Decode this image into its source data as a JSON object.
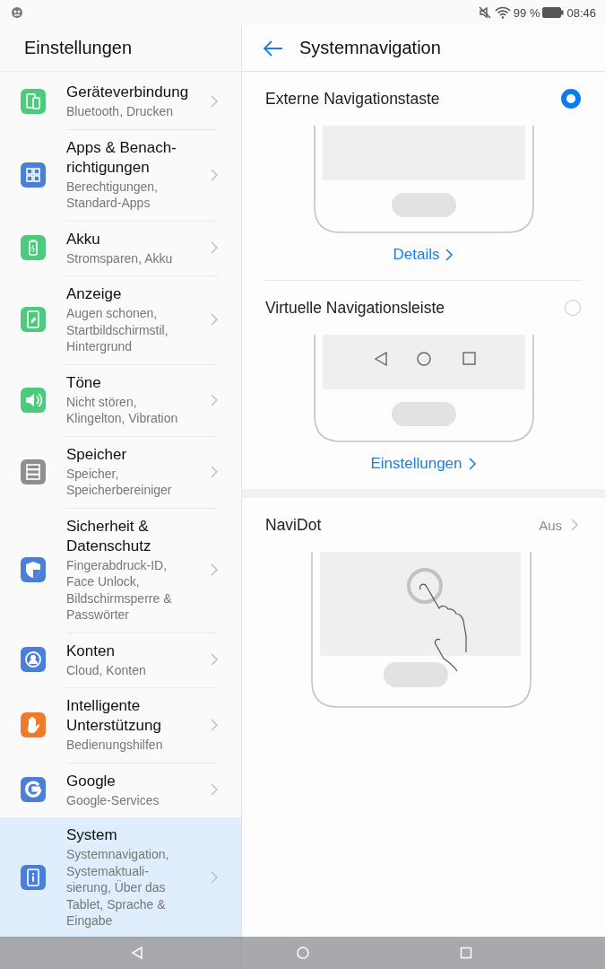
{
  "status_bar": {
    "battery": "99 %",
    "time": "08:46"
  },
  "sidebar": {
    "title": "Einstellungen",
    "items": [
      {
        "title_lines": [
          "Geräteverbindung"
        ],
        "subtitle_lines": [
          "Bluetooth, Drucken"
        ],
        "color": "#4ccb7d",
        "selected": false
      },
      {
        "title_lines": [
          "Apps & Benach-",
          "richtigungen"
        ],
        "subtitle_lines": [
          "Berechtigungen,",
          "Standard-Apps"
        ],
        "color": "#4a7fd9",
        "selected": false
      },
      {
        "title_lines": [
          "Akku"
        ],
        "subtitle_lines": [
          "Stromsparen, Akku"
        ],
        "color": "#4ccb7d",
        "selected": false
      },
      {
        "title_lines": [
          "Anzeige"
        ],
        "subtitle_lines": [
          "Augen schonen,",
          "Startbildschirmstil,",
          "Hintergrund"
        ],
        "color": "#4ccb7d",
        "selected": false
      },
      {
        "title_lines": [
          "Töne"
        ],
        "subtitle_lines": [
          "Nicht stören,",
          "Klingelton, Vibration"
        ],
        "color": "#4ccb7d",
        "selected": false
      },
      {
        "title_lines": [
          "Speicher"
        ],
        "subtitle_lines": [
          "Speicher,",
          "Speicherbereiniger"
        ],
        "color": "#8f8f8f",
        "selected": false
      },
      {
        "title_lines": [
          "Sicherheit &",
          "Datenschutz"
        ],
        "subtitle_lines": [
          "Fingerabdruck-ID,",
          "Face Unlock,",
          "Bildschirmsperre &",
          "Passwörter"
        ],
        "color": "#4a7fd9",
        "selected": false
      },
      {
        "title_lines": [
          "Konten"
        ],
        "subtitle_lines": [
          "Cloud, Konten"
        ],
        "color": "#4a7fd9",
        "selected": false
      },
      {
        "title_lines": [
          "Intelligente",
          "Unterstützung"
        ],
        "subtitle_lines": [
          "Bedienungshilfen"
        ],
        "color": "#f07a2c",
        "selected": false
      },
      {
        "title_lines": [
          "Google"
        ],
        "subtitle_lines": [
          "Google-Services"
        ],
        "color": "#4a7fd9",
        "selected": false
      },
      {
        "title_lines": [
          "System"
        ],
        "subtitle_lines": [
          "Systemnavigation,",
          "Systemaktuali-",
          "sierung, Über das",
          "Tablet, Sprache &",
          "Eingabe"
        ],
        "color": "#4a7fd9",
        "selected": true
      }
    ]
  },
  "page": {
    "title": "Systemnavigation",
    "options": [
      {
        "label": "Externe Navigationstaste",
        "selected": true,
        "link": "Details"
      },
      {
        "label": "Virtuelle Navigationsleiste",
        "selected": false,
        "link": "Einstellungen"
      }
    ],
    "navidot": {
      "label": "NaviDot",
      "value": "Aus"
    }
  }
}
